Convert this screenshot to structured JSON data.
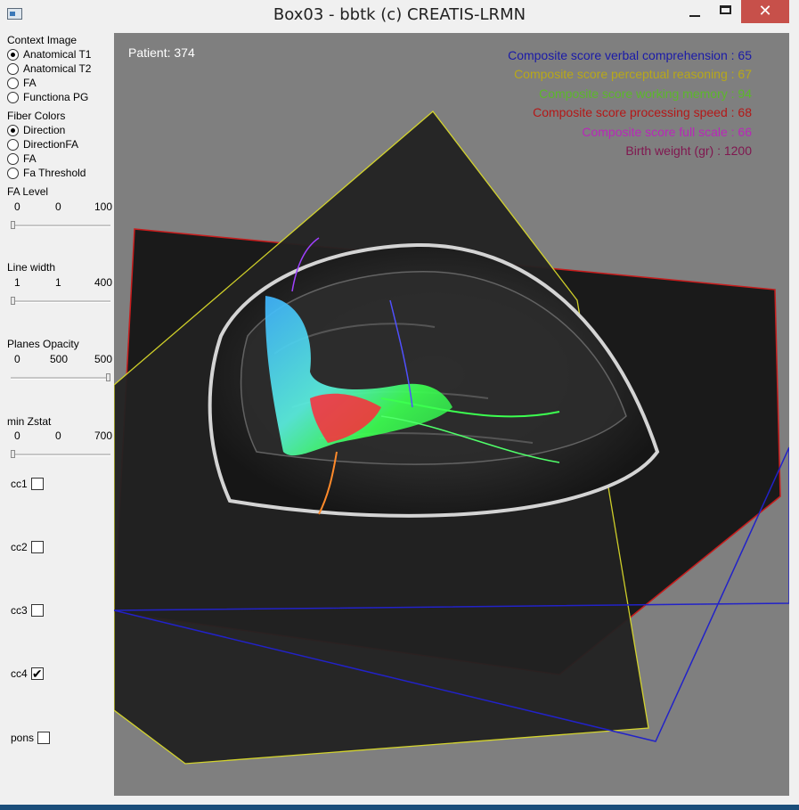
{
  "window": {
    "title": "Box03 - bbtk (c) CREATIS-LRMN",
    "close_label": "✕"
  },
  "panel": {
    "context_image": {
      "label": "Context Image",
      "options": [
        "Anatomical T1",
        "Anatomical T2",
        "FA",
        "Functiona PG"
      ],
      "selected": 0
    },
    "fiber_colors": {
      "label": "Fiber Colors",
      "options": [
        "Direction",
        "DirectionFA",
        "FA",
        "Fa Threshold"
      ],
      "selected": 0
    },
    "fa_level": {
      "label": "FA Level",
      "min": "0",
      "value": "0",
      "max": "100",
      "fraction": 0.0
    },
    "line_width": {
      "label": "Line width",
      "min": "1",
      "value": "1",
      "max": "400",
      "fraction": 0.0
    },
    "planes_opacity": {
      "label": "Planes Opacity",
      "min": "0",
      "value": "500",
      "max": "500",
      "fraction": 1.0
    },
    "min_zstat": {
      "label": "min Zstat",
      "min": "0",
      "value": "0",
      "max": "700",
      "fraction": 0.0
    },
    "checkboxes": [
      {
        "label": "cc1",
        "checked": false
      },
      {
        "label": "cc2",
        "checked": false
      },
      {
        "label": "cc3",
        "checked": false
      },
      {
        "label": "cc4",
        "checked": true
      },
      {
        "label": "pons",
        "checked": false
      }
    ]
  },
  "viewport": {
    "patient": "Patient: 374",
    "scores": [
      {
        "text": "Composite score verbal comprehension : 65",
        "color": "#1a1aa8"
      },
      {
        "text": "Composite score perceptual reasoning : 67",
        "color": "#b8a818"
      },
      {
        "text": "Composite score working memory : 94",
        "color": "#5cb82a"
      },
      {
        "text": "Composite score processing speed : 68",
        "color": "#b41818"
      },
      {
        "text": "Composite score full scale : 66",
        "color": "#b828b8"
      },
      {
        "text": "Birth weight (gr) : 1200",
        "color": "#801850"
      }
    ]
  }
}
